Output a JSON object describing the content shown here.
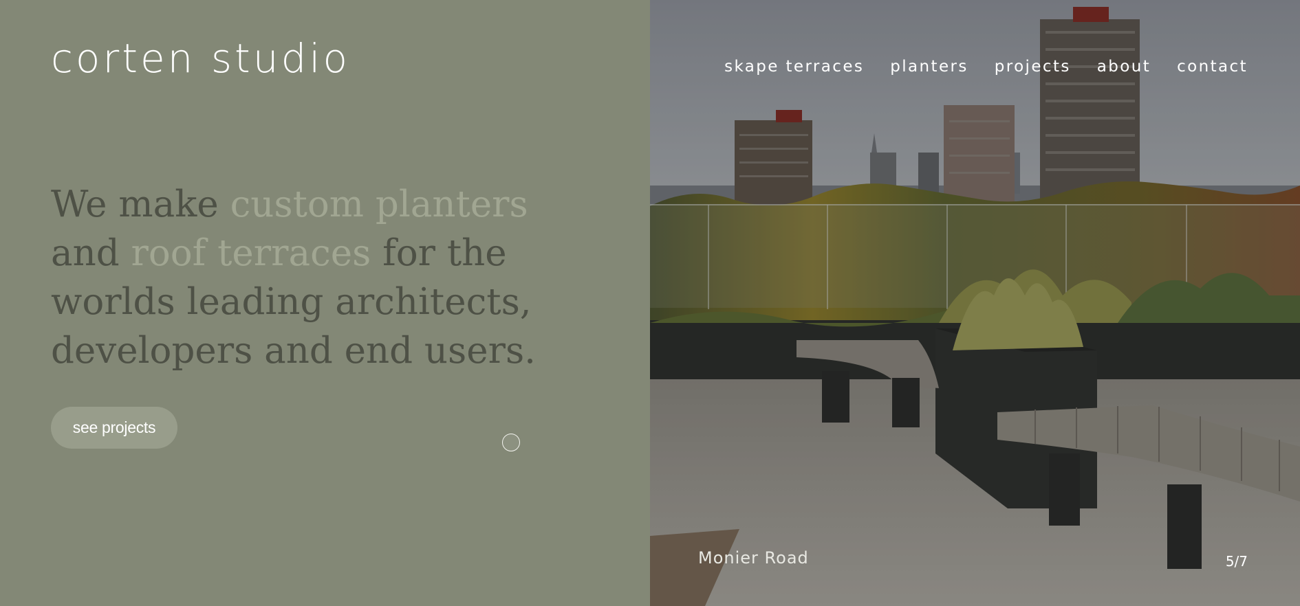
{
  "brand": {
    "logo_text": "corten studio"
  },
  "nav": {
    "items": [
      {
        "label": "skape terraces"
      },
      {
        "label": "planters"
      },
      {
        "label": "projects"
      },
      {
        "label": "about"
      },
      {
        "label": "contact"
      }
    ]
  },
  "hero": {
    "intro": {
      "part1": "We make ",
      "highlight1": "custom planters",
      "part2": " and ",
      "highlight2": "roof terraces",
      "part3": " for the worlds leading architects, developers and end users."
    },
    "cta_label": "see projects"
  },
  "slideshow": {
    "caption": "Monier Road",
    "counter": "5/7"
  },
  "colors": {
    "panel_bg": "#838876",
    "intro_text": "#4e5146",
    "intro_highlight": "#a1a692",
    "button_bg": "#989d8b",
    "white": "#ffffff"
  },
  "icons": {
    "cursor": "cursor-ring-icon"
  }
}
